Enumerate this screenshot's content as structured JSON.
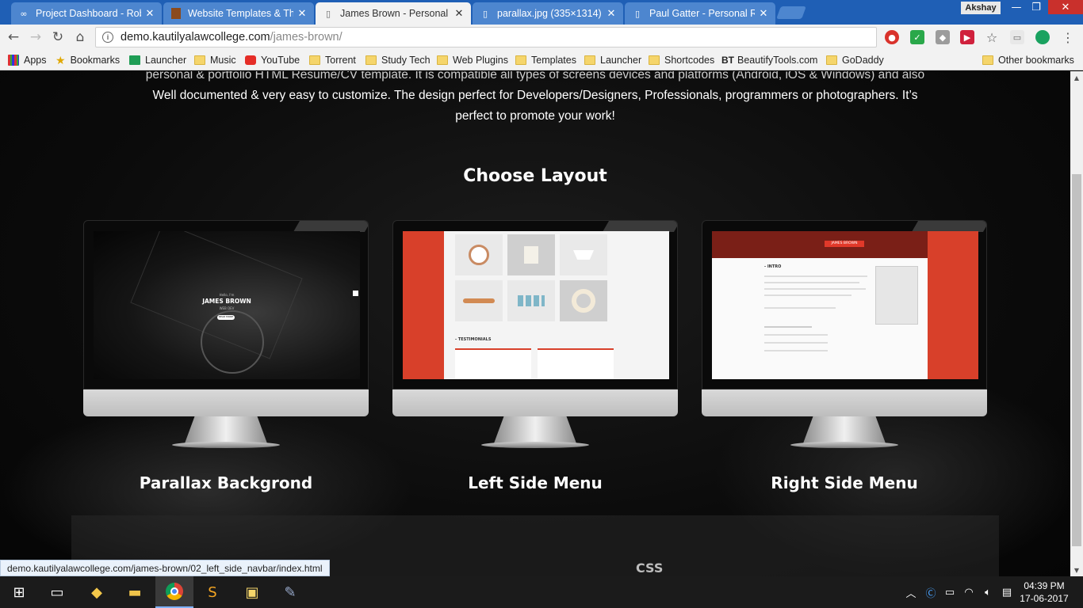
{
  "browser": {
    "tabs": [
      {
        "title": "Project Dashboard - Rob",
        "icon": "infinity-icon",
        "active": false
      },
      {
        "title": "Website Templates & The",
        "icon": "book-icon",
        "active": false
      },
      {
        "title": "James Brown - Personal R",
        "icon": "page-icon",
        "active": true
      },
      {
        "title": "parallax.jpg (335×1314)",
        "icon": "page-icon",
        "active": false
      },
      {
        "title": "Paul Gatter - Personal Re",
        "icon": "page-icon",
        "active": false
      }
    ],
    "profile_name": "Akshay",
    "url_host": "demo.kautilyalawcollege.com",
    "url_path": "/james-brown/",
    "bookmarks": [
      {
        "label": "Apps",
        "icon": "apps-icon"
      },
      {
        "label": "Bookmarks",
        "icon": "star-icon"
      },
      {
        "label": "Launcher",
        "icon": "sheet-icon"
      },
      {
        "label": "Music",
        "icon": "folder-icon"
      },
      {
        "label": "YouTube",
        "icon": "youtube-icon"
      },
      {
        "label": "Torrent",
        "icon": "folder-icon"
      },
      {
        "label": "Study Tech",
        "icon": "folder-icon"
      },
      {
        "label": "Web Plugins",
        "icon": "folder-icon"
      },
      {
        "label": "Templates",
        "icon": "folder-icon"
      },
      {
        "label": "Launcher",
        "icon": "folder-icon"
      },
      {
        "label": "Shortcodes",
        "icon": "folder-icon"
      },
      {
        "label": "BeautifyTools.com",
        "icon": "bt-icon"
      },
      {
        "label": "GoDaddy",
        "icon": "folder-icon"
      },
      {
        "label": "Other bookmarks",
        "icon": "folder-icon"
      }
    ],
    "status_url": "demo.kautilyalawcollege.com/james-brown/02_left_side_navbar/index.html"
  },
  "page": {
    "intro_line1": "personal & portfolio HTML Resume/CV template. It is compatible all types of screens devices and platforms (Android, iOS & Windows) and also",
    "intro_line2": "Well documented & very easy to customize. The design perfect for Developers/Designers, Professionals, programmers or photographers. It’s",
    "intro_line3": "perfect to promote your work!",
    "heading": "Choose Layout",
    "layouts": [
      {
        "label": "Parallax Backgrond"
      },
      {
        "label": "Left Side Menu"
      },
      {
        "label": "Right Side Menu"
      }
    ],
    "preview1": {
      "hello": "Hello, I'm",
      "name": "JAMES BROWN",
      "role": "WEB DEV",
      "button": "READ MORE"
    },
    "preview2": {
      "section": "- TESTIMONIALS"
    },
    "preview3": {
      "name": "JAMES BROWN",
      "section": "- INTRO"
    },
    "css_fragment": "CSS"
  },
  "taskbar": {
    "time": "04:39 PM",
    "date": "17-06-2017"
  },
  "colors": {
    "tabstrip": "#1f5fb5",
    "accent_red": "#d8402a"
  }
}
